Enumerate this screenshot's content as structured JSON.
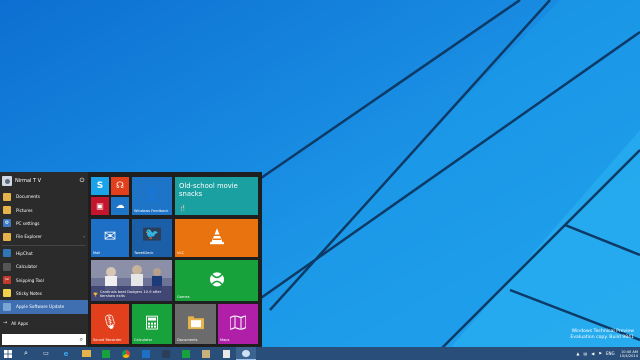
{
  "start_menu": {
    "user_name": "Nirmal T V",
    "apps": [
      {
        "label": "Documents",
        "icon": "folder-icon",
        "color": "#e6b34a"
      },
      {
        "label": "Pictures",
        "icon": "pictures-icon",
        "color": "#e6b34a"
      },
      {
        "label": "PC settings",
        "icon": "gear-icon",
        "color": "#3d7ac2"
      },
      {
        "label": "File Explorer",
        "icon": "file-explorer-icon",
        "color": "#e6b34a",
        "has_arrow": true
      },
      {
        "label": "HipChat",
        "icon": "hipchat-icon",
        "color": "#2f75b8"
      },
      {
        "label": "Calculator",
        "icon": "calculator-icon",
        "color": "#555555"
      },
      {
        "label": "Snipping Tool",
        "icon": "scissors-icon",
        "color": "#c0392b"
      },
      {
        "label": "Sticky Notes",
        "icon": "sticky-notes-icon",
        "color": "#f1d24a"
      },
      {
        "label": "Apple Software Update",
        "icon": "apple-update-icon",
        "color": "#7aa6d6"
      }
    ],
    "all_apps_label": "All Apps"
  },
  "tiles": [
    {
      "id": "skype",
      "label": "",
      "icon": "skype-icon",
      "color": "#1aa3e8"
    },
    {
      "id": "music",
      "label": "",
      "icon": "headphones-icon",
      "color": "#e2401c"
    },
    {
      "id": "video",
      "label": "",
      "icon": "video-icon",
      "color": "#c3162c"
    },
    {
      "id": "onedrive",
      "label": "",
      "icon": "cloud-icon",
      "color": "#1e74c6"
    },
    {
      "id": "feedback",
      "label": "Windows Feedback",
      "icon": "feedback-icon",
      "color": "#1e74c6"
    },
    {
      "id": "movies",
      "label": "Old-school movie snacks",
      "icon": "food-icon",
      "color": "#1aa0a0"
    },
    {
      "id": "mail",
      "label": "Mail",
      "icon": "mail-icon",
      "color": "#1e6fc6"
    },
    {
      "id": "tweetdeck",
      "label": "TweetDeck",
      "icon": "twitter-icon",
      "color": "#1a5fa8"
    },
    {
      "id": "vlc",
      "label": "VLC",
      "icon": "vlc-icon",
      "color": "#e8730f"
    },
    {
      "id": "sports",
      "label": "Cardinals beat Dodgers 10-9 after Kershaw exits",
      "icon": "sports-icon",
      "color": "#4b4f8a"
    },
    {
      "id": "games",
      "label": "Games",
      "icon": "xbox-icon",
      "color": "#17a23b"
    },
    {
      "id": "sound",
      "label": "Sound Recorder",
      "icon": "microphone-icon",
      "color": "#e2401c"
    },
    {
      "id": "calculator",
      "label": "Calculator",
      "icon": "calculator-icon",
      "color": "#17a23b"
    },
    {
      "id": "documents",
      "label": "Documents",
      "icon": "folder-icon",
      "color": "#6b6b6b"
    },
    {
      "id": "maps",
      "label": "Maps",
      "icon": "map-icon",
      "color": "#b01fa8"
    }
  ],
  "taskbar": {
    "items": [
      {
        "icon": "windows-start-icon",
        "active": false
      },
      {
        "icon": "search-icon",
        "active": false
      },
      {
        "icon": "task-view-icon",
        "active": false
      },
      {
        "icon": "internet-explorer-icon",
        "active": false
      },
      {
        "icon": "file-explorer-icon",
        "active": false
      },
      {
        "icon": "store-icon",
        "active": false
      },
      {
        "icon": "chrome-icon",
        "active": false
      },
      {
        "icon": "outlook-icon",
        "active": false
      },
      {
        "icon": "tweetdeck-icon",
        "active": false
      },
      {
        "icon": "excel-icon",
        "active": false
      },
      {
        "icon": "photos-icon",
        "active": false
      },
      {
        "icon": "notepad-icon",
        "active": false
      },
      {
        "icon": "chat-icon",
        "active": true
      }
    ],
    "tray": {
      "language": "ENG",
      "time": "10:40 AM",
      "date": "10/4/2014"
    }
  },
  "watermark": {
    "line1": "Windows Technical Preview",
    "line2": "Evaluation copy. Build 9841"
  },
  "colors": {
    "desktop_bg": "#1a8fe0",
    "start_bg": "#1f1f1f",
    "taskbar_bg": "#2a4e7a"
  }
}
